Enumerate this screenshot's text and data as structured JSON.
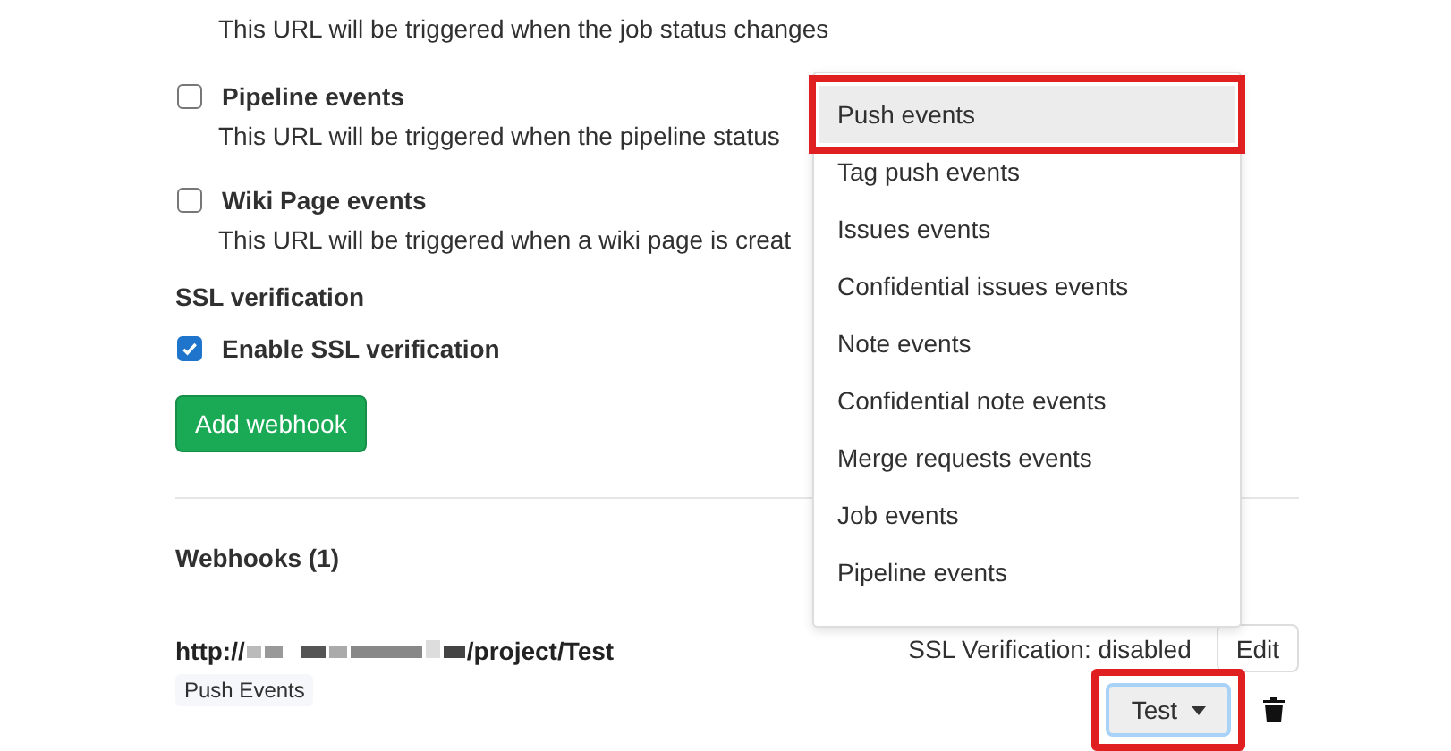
{
  "top_description": "This URL will be triggered when the job status changes",
  "triggers": [
    {
      "label": "Pipeline events",
      "description": "This URL will be triggered when the pipeline status",
      "checked": false
    },
    {
      "label": "Wiki Page events",
      "description": "This URL will be triggered when a wiki page is creat",
      "checked": false
    }
  ],
  "ssl": {
    "heading": "SSL verification",
    "label": "Enable SSL verification",
    "checked": true
  },
  "add_button": "Add webhook",
  "webhooks": {
    "heading": "Webhooks (1)",
    "items": [
      {
        "url_start": "http://",
        "url_end": "/project/Test",
        "tag": "Push Events",
        "ssl_status": "SSL Verification: disabled",
        "edit": "Edit",
        "test": {
          "label": "Test",
          "highlighted": true
        }
      }
    ]
  },
  "test_menu": [
    {
      "label": "Push events",
      "selected": true,
      "highlighted": true
    },
    {
      "label": "Tag push events",
      "selected": false,
      "highlighted": false
    },
    {
      "label": "Issues events",
      "selected": false,
      "highlighted": false
    },
    {
      "label": "Confidential issues events",
      "selected": false,
      "highlighted": false
    },
    {
      "label": "Note events",
      "selected": false,
      "highlighted": false
    },
    {
      "label": "Confidential note events",
      "selected": false,
      "highlighted": false
    },
    {
      "label": "Merge requests events",
      "selected": false,
      "highlighted": false
    },
    {
      "label": "Job events",
      "selected": false,
      "highlighted": false
    },
    {
      "label": "Pipeline events",
      "selected": false,
      "highlighted": false
    }
  ]
}
